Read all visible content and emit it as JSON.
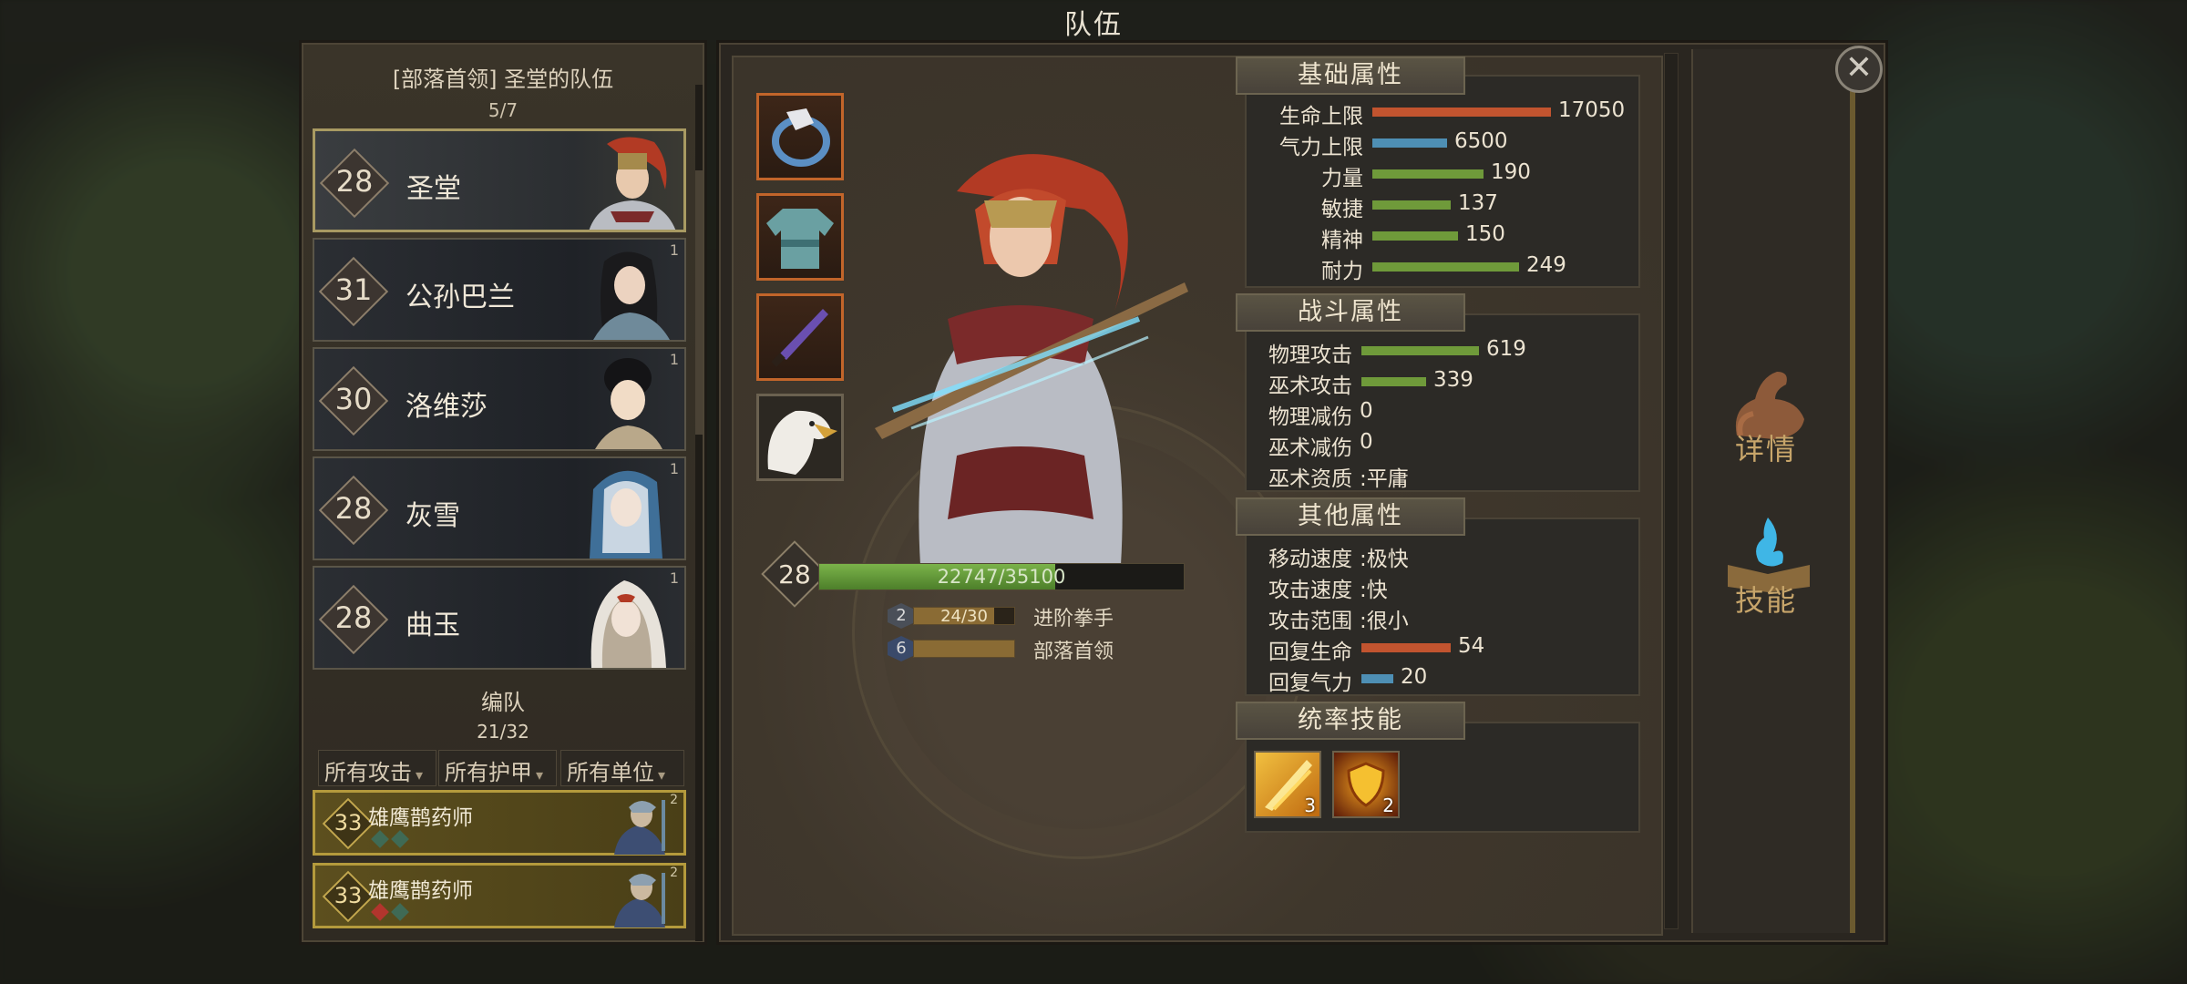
{
  "window": {
    "title": "队伍"
  },
  "party": {
    "header": "[部落首领] 圣堂的队伍",
    "count": "5/7",
    "heroes": [
      {
        "level": "28",
        "name": "圣堂",
        "badge": ""
      },
      {
        "level": "31",
        "name": "公孙巴兰",
        "badge": "1"
      },
      {
        "level": "30",
        "name": "洛维莎",
        "badge": "1"
      },
      {
        "level": "28",
        "name": "灰雪",
        "badge": "1"
      },
      {
        "level": "28",
        "name": "曲玉",
        "badge": "1"
      }
    ]
  },
  "formation": {
    "header": "编队",
    "count": "21/32",
    "filters": [
      "所有攻击",
      "所有护甲",
      "所有单位"
    ],
    "units": [
      {
        "level": "33",
        "name": "雄鹰鹊药师",
        "badge": "2",
        "gems": [
          "#3f6a55",
          "#3f6a55"
        ]
      },
      {
        "level": "33",
        "name": "雄鹰鹊药师",
        "badge": "2",
        "gems": [
          "#b2352d",
          "#3f6a55"
        ]
      }
    ]
  },
  "character": {
    "level": "28",
    "xp": {
      "text": "22747/35100",
      "fraction": 0.648
    },
    "rank": {
      "badge": "2",
      "text": "24/30",
      "fraction": 0.8,
      "label": "进阶拳手"
    },
    "title_rank": {
      "badge": "6",
      "fraction": 1.0,
      "label": "部落首领"
    }
  },
  "base_stats": {
    "title": "基础属性",
    "items": [
      {
        "name": "生命上限",
        "value": "17050",
        "color": "#c2542f",
        "fraction": 1.0
      },
      {
        "name": "气力上限",
        "value": "6500",
        "color": "#4e8fb4",
        "fraction": 0.42
      },
      {
        "name": "力量",
        "value": "190",
        "color": "#6f9a3a",
        "fraction": 0.62
      },
      {
        "name": "敏捷",
        "value": "137",
        "color": "#6f9a3a",
        "fraction": 0.44
      },
      {
        "name": "精神",
        "value": "150",
        "color": "#6f9a3a",
        "fraction": 0.48
      },
      {
        "name": "耐力",
        "value": "249",
        "color": "#6f9a3a",
        "fraction": 0.82
      }
    ]
  },
  "combat_stats": {
    "title": "战斗属性",
    "items": [
      {
        "name": "物理攻击",
        "value": "619",
        "color": "#6f9a3a",
        "fraction": 0.66
      },
      {
        "name": "巫术攻击",
        "value": "339",
        "color": "#6f9a3a",
        "fraction": 0.36
      },
      {
        "name": "物理减伤",
        "value": "0"
      },
      {
        "name": "巫术减伤",
        "value": "0"
      },
      {
        "name": "巫术资质",
        "value": ":平庸"
      }
    ]
  },
  "other_stats": {
    "title": "其他属性",
    "items": [
      {
        "name": "移动速度",
        "value": ":极快"
      },
      {
        "name": "攻击速度",
        "value": ":快"
      },
      {
        "name": "攻击范围",
        "value": ":很小"
      },
      {
        "name": "回复生命",
        "value": "54",
        "color": "#c2542f",
        "fraction": 0.5
      },
      {
        "name": "回复气力",
        "value": "20",
        "color": "#4e8fb4",
        "fraction": 0.18
      }
    ]
  },
  "command_skills": {
    "title": "统率技能",
    "items": [
      {
        "icon": "golden-slash-icon",
        "count": "3"
      },
      {
        "icon": "golden-shield-icon",
        "count": "2"
      }
    ]
  },
  "side_buttons": {
    "details": "详情",
    "skills": "技能"
  },
  "equipment": [
    "ring-icon",
    "tunic-icon",
    "dagger-icon",
    "eagle-icon"
  ]
}
